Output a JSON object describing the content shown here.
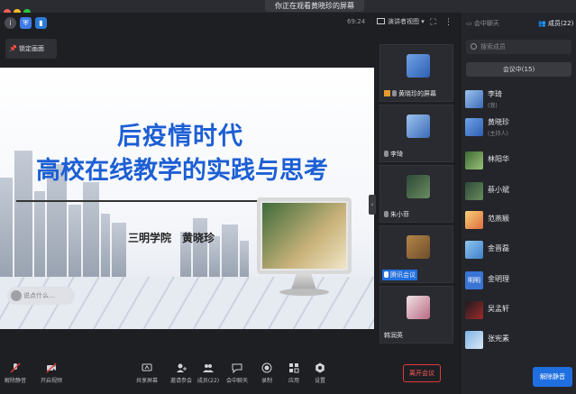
{
  "window": {
    "title": "你正在观看黄晓珍的屏幕"
  },
  "toolbar": {
    "timer": "69:24",
    "view_switch": "演讲者视图"
  },
  "lock_button": {
    "label": "锁定画面"
  },
  "slide": {
    "title_line1": "后疫情时代",
    "title_line2": "高校在线教学的实践与思考",
    "author": "三明学院　黄晓珍",
    "chat_placeholder": "说点什么…"
  },
  "video_tiles": [
    {
      "name": "黄晓珍的屏幕",
      "highlight": false
    },
    {
      "name": "李琦",
      "highlight": false
    },
    {
      "name": "朱小菲",
      "highlight": false
    },
    {
      "name": "腾讯会议",
      "highlight": true
    },
    {
      "name": "韩润英",
      "highlight": false
    }
  ],
  "right_panel": {
    "tab_chat": "会中聊天",
    "tab_members": "成员(22)",
    "search_placeholder": "搜索成员",
    "segment_label": "会议中(15)",
    "members": [
      {
        "name": "李琦",
        "role": "(我)"
      },
      {
        "name": "黄晓珍",
        "role": "(主持人)"
      },
      {
        "name": "林阳华",
        "role": ""
      },
      {
        "name": "蔡小斌",
        "role": ""
      },
      {
        "name": "范燕颖",
        "role": ""
      },
      {
        "name": "金晋磊",
        "role": ""
      },
      {
        "name": "金明理",
        "role": ""
      },
      {
        "name": "吴孟轩",
        "role": ""
      },
      {
        "name": "张宪素",
        "role": ""
      }
    ],
    "unmute_all": "解除静音"
  },
  "bottom_bar": {
    "mute": "解除静音",
    "video": "开启视频",
    "share": "共享屏幕",
    "invite": "邀请参会",
    "members": "成员(22)",
    "chat": "会中聊天",
    "record": "录制",
    "apps": "应用",
    "settings": "设置",
    "leave": "离开会议"
  }
}
